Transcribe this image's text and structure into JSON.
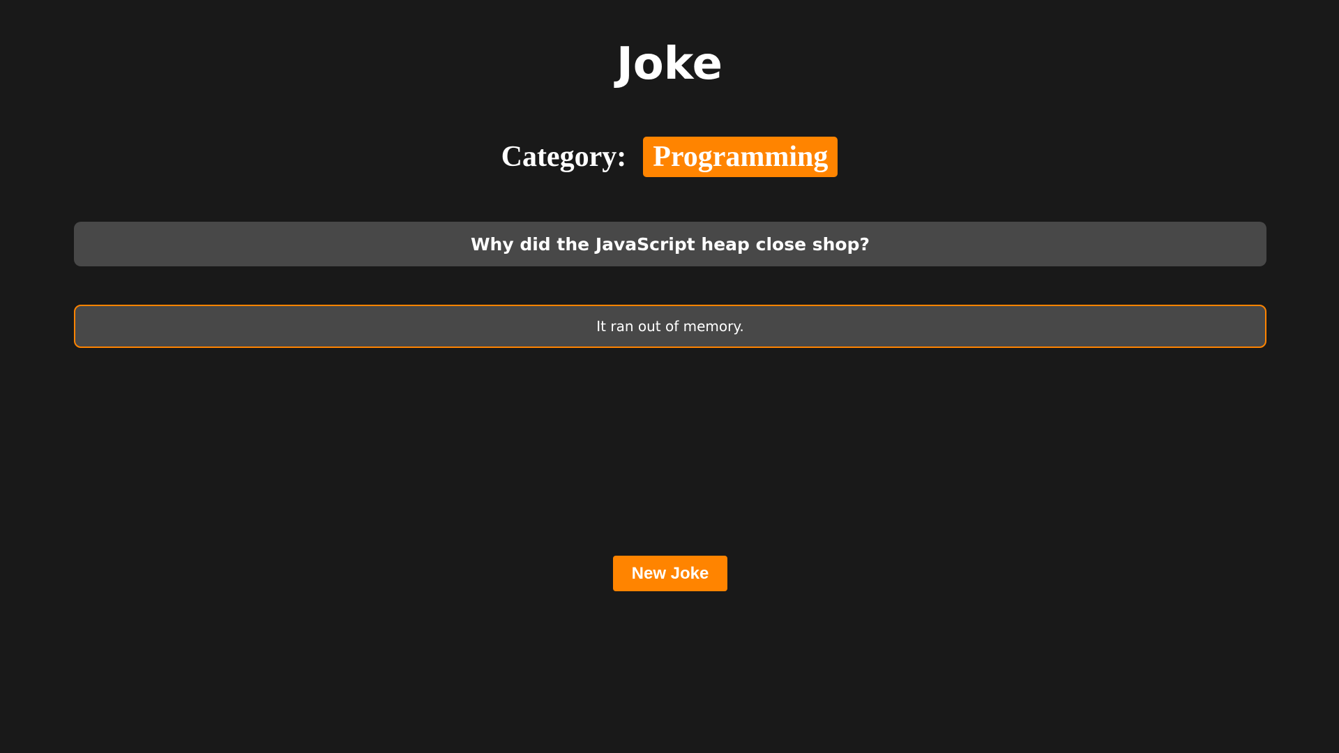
{
  "page": {
    "title": "Joke"
  },
  "category": {
    "label": "Category:",
    "value": "Programming"
  },
  "joke": {
    "setup": "Why did the JavaScript heap close shop?",
    "delivery": "It ran out of memory."
  },
  "actions": {
    "new_joke_label": "New Joke"
  },
  "colors": {
    "background": "#191919",
    "accent": "#ff8400",
    "card": "#484848",
    "text": "#ffffff"
  }
}
